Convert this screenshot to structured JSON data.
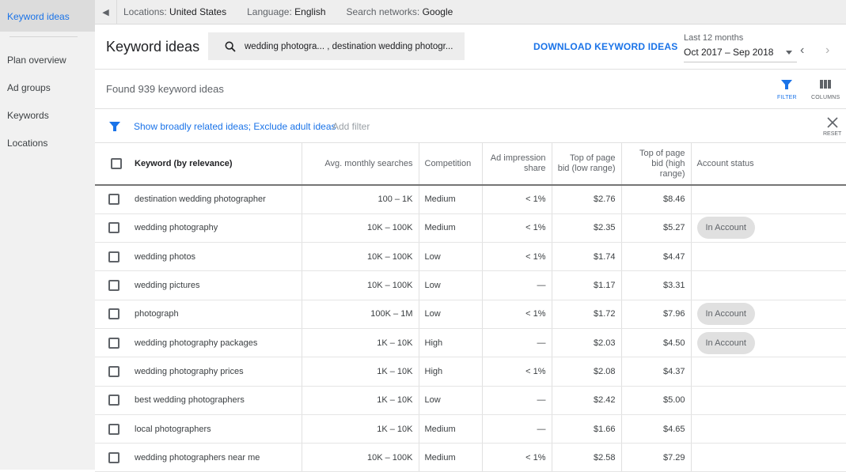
{
  "sidebar": {
    "items": [
      {
        "label": "Keyword ideas",
        "active": true
      },
      {
        "label": "Plan overview"
      },
      {
        "label": "Ad groups"
      },
      {
        "label": "Keywords"
      },
      {
        "label": "Locations"
      }
    ]
  },
  "topbar": {
    "locations_label": "Locations:",
    "locations_value": "United States",
    "language_label": "Language:",
    "language_value": "English",
    "networks_label": "Search networks:",
    "networks_value": "Google"
  },
  "header": {
    "title": "Keyword ideas",
    "search_value": "wedding photogra...  , destination wedding photogr...",
    "download_label": "DOWNLOAD KEYWORD IDEAS",
    "date_range_label": "Last 12 months",
    "date_range_value": "Oct 2017 – Sep 2018"
  },
  "results": {
    "found_text": "Found 939 keyword ideas",
    "filter_label": "FILTER",
    "columns_label": "COLUMNS"
  },
  "filters": {
    "active_text": "Show broadly related ideas; Exclude adult ideas",
    "add_filter": "Add filter",
    "reset_label": "RESET"
  },
  "table": {
    "headers": {
      "keyword": "Keyword (by relevance)",
      "searches": "Avg. monthly searches",
      "competition": "Competition",
      "impression": "Ad impression share",
      "bid_low": "Top of page bid (low range)",
      "bid_high": "Top of page bid (high range)",
      "status": "Account status"
    },
    "rows": [
      {
        "keyword": "destination wedding photographer",
        "searches": "100 – 1K",
        "competition": "Medium",
        "impression": "< 1%",
        "bid_low": "$2.76",
        "bid_high": "$8.46",
        "status": ""
      },
      {
        "keyword": "wedding photography",
        "searches": "10K – 100K",
        "competition": "Medium",
        "impression": "< 1%",
        "bid_low": "$2.35",
        "bid_high": "$5.27",
        "status": "In Account"
      },
      {
        "keyword": "wedding photos",
        "searches": "10K – 100K",
        "competition": "Low",
        "impression": "< 1%",
        "bid_low": "$1.74",
        "bid_high": "$4.47",
        "status": ""
      },
      {
        "keyword": "wedding pictures",
        "searches": "10K – 100K",
        "competition": "Low",
        "impression": "—",
        "bid_low": "$1.17",
        "bid_high": "$3.31",
        "status": ""
      },
      {
        "keyword": "photograph",
        "searches": "100K – 1M",
        "competition": "Low",
        "impression": "< 1%",
        "bid_low": "$1.72",
        "bid_high": "$7.96",
        "status": "In Account"
      },
      {
        "keyword": "wedding photography packages",
        "searches": "1K – 10K",
        "competition": "High",
        "impression": "—",
        "bid_low": "$2.03",
        "bid_high": "$4.50",
        "status": "In Account"
      },
      {
        "keyword": "wedding photography prices",
        "searches": "1K – 10K",
        "competition": "High",
        "impression": "< 1%",
        "bid_low": "$2.08",
        "bid_high": "$4.37",
        "status": ""
      },
      {
        "keyword": "best wedding photographers",
        "searches": "1K – 10K",
        "competition": "Low",
        "impression": "—",
        "bid_low": "$2.42",
        "bid_high": "$5.00",
        "status": ""
      },
      {
        "keyword": "local photographers",
        "searches": "1K – 10K",
        "competition": "Medium",
        "impression": "—",
        "bid_low": "$1.66",
        "bid_high": "$4.65",
        "status": ""
      },
      {
        "keyword": "wedding photographers near me",
        "searches": "10K – 100K",
        "competition": "Medium",
        "impression": "< 1%",
        "bid_low": "$2.58",
        "bid_high": "$7.29",
        "status": ""
      }
    ]
  },
  "colors": {
    "accent": "#1a73e8",
    "sidebar_bg": "#f1f1f1",
    "pill_bg": "#e0e0e0"
  }
}
